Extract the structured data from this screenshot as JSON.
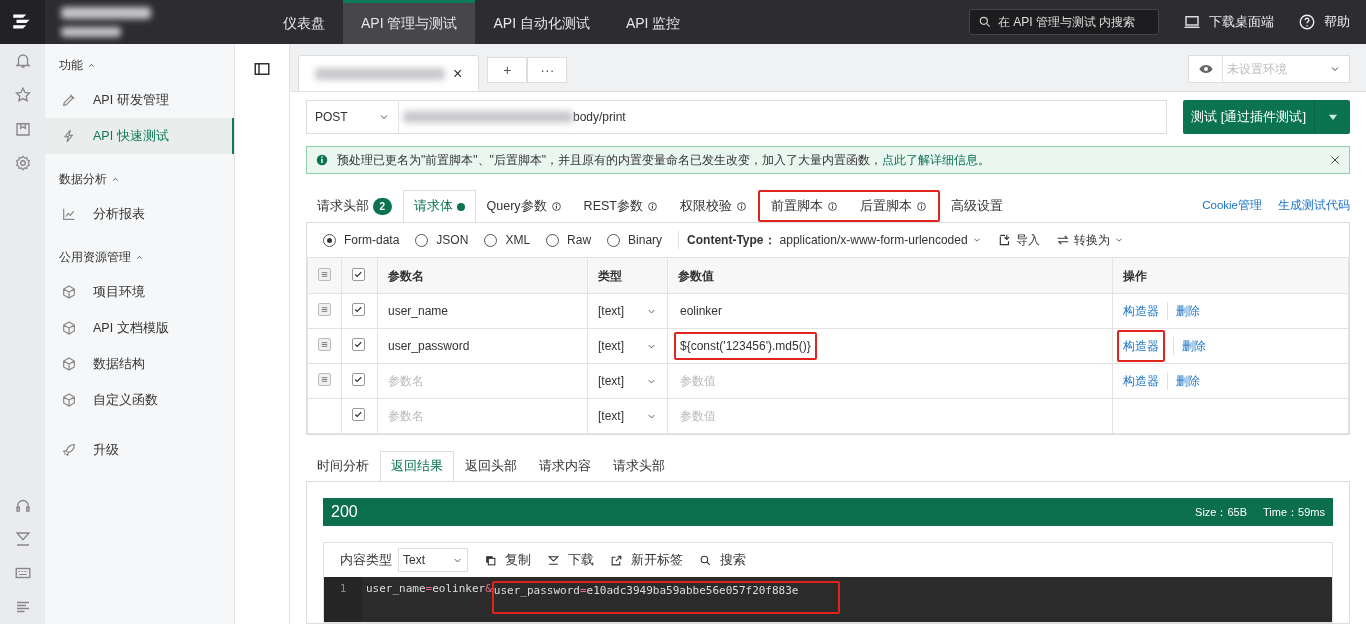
{
  "top_nav": [
    {
      "label": "仪表盘",
      "selected": false
    },
    {
      "label": "API 管理与测试",
      "selected": true
    },
    {
      "label": "API 自动化测试",
      "selected": false
    },
    {
      "label": "API 监控",
      "selected": false
    }
  ],
  "search": {
    "placeholder": "在 API 管理与测试 内搜索"
  },
  "header_actions": [
    {
      "kind": "desktop",
      "label": "下载桌面端"
    },
    {
      "kind": "help",
      "label": "帮助"
    }
  ],
  "sidebar": [
    {
      "title": "功能",
      "expanded": true,
      "items": [
        {
          "label": "API 研发管理",
          "kind": "edit",
          "selected": false
        },
        {
          "label": "API 快速测试",
          "kind": "flash",
          "selected": true
        }
      ]
    },
    {
      "title": "数据分析",
      "expanded": true,
      "items": [
        {
          "label": "分析报表",
          "kind": "chart",
          "selected": false
        }
      ]
    },
    {
      "title": "公用资源管理",
      "expanded": true,
      "items": [
        {
          "label": "项目环境",
          "kind": "cube",
          "selected": false
        },
        {
          "label": "API 文档模版",
          "kind": "cube",
          "selected": false
        },
        {
          "label": "数据结构",
          "kind": "cube",
          "selected": false
        },
        {
          "label": "自定义函数",
          "kind": "cube",
          "selected": false
        }
      ]
    },
    {
      "items": [
        {
          "label": "升级",
          "kind": "rocket",
          "selected": false
        }
      ]
    }
  ],
  "request_tab": {
    "close": "×"
  },
  "tab_buttons": [
    "+",
    "···"
  ],
  "environment": {
    "placeholder": "未设置环境"
  },
  "method": "POST",
  "url": {
    "value": "body/print"
  },
  "test_button": "测试 [通过插件测试]",
  "alert": {
    "text": "预处理已更名为\"前置脚本\"、\"后置脚本\"，并且原有的内置变量命名已发生改变，加入了大量内置函数，",
    "link": "点此了解详细信息",
    "after": "。"
  },
  "request_tabs": [
    {
      "label": "请求头部",
      "badge": "2",
      "selected": false
    },
    {
      "label": "请求体",
      "dot": true,
      "selected": true
    },
    {
      "label": "Query参数",
      "info": true,
      "selected": false
    },
    {
      "label": "REST参数",
      "info": true,
      "selected": false
    },
    {
      "label": "权限校验",
      "info": true,
      "selected": false
    },
    {
      "label": "前置脚本",
      "info": true,
      "selected": false,
      "annotated": true
    },
    {
      "label": "后置脚本",
      "info": true,
      "selected": false,
      "annotated": true
    },
    {
      "label": "高级设置",
      "selected": false
    }
  ],
  "request_links": [
    "Cookie管理",
    "生成测试代码"
  ],
  "body_types": [
    {
      "label": "Form-data",
      "selected": true
    },
    {
      "label": "JSON",
      "selected": false
    },
    {
      "label": "XML",
      "selected": false
    },
    {
      "label": "Raw",
      "selected": false
    },
    {
      "label": "Binary",
      "selected": false
    }
  ],
  "content_type": {
    "label": "Content-Type：",
    "value": "application/x-www-form-urlencoded"
  },
  "body_actions": [
    {
      "kind": "import",
      "label": "导入"
    },
    {
      "kind": "convert",
      "label": "转换为"
    }
  ],
  "table": {
    "header_checked": true,
    "columns": [
      "参数名",
      "类型",
      "参数值",
      "操作"
    ],
    "rows": [
      {
        "draggable": true,
        "checked": true,
        "name": "user_name",
        "type": "[text]",
        "value": "eolinker",
        "actions": [
          {
            "label": "构造器"
          },
          {
            "label": "删除"
          }
        ]
      },
      {
        "draggable": true,
        "checked": true,
        "name": "user_password",
        "type": "[text]",
        "value": "${const('123456').md5()}",
        "value_annotated": true,
        "actions": [
          {
            "label": "构造器",
            "annotated": true
          },
          {
            "label": "删除"
          }
        ]
      },
      {
        "draggable": true,
        "checked": true,
        "name_placeholder": "参数名",
        "type": "[text]",
        "value_placeholder": "参数值",
        "actions": [
          {
            "label": "构造器"
          },
          {
            "label": "删除"
          }
        ]
      },
      {
        "draggable": false,
        "checked": true,
        "name_placeholder": "参数名",
        "type": "[text]",
        "value_placeholder": "参数值"
      }
    ]
  },
  "response_tabs": [
    {
      "label": "时间分析",
      "selected": false
    },
    {
      "label": "返回结果",
      "selected": true
    },
    {
      "label": "返回头部",
      "selected": false
    },
    {
      "label": "请求内容",
      "selected": false
    },
    {
      "label": "请求头部",
      "selected": false
    }
  ],
  "response": {
    "status": "200",
    "size": "Size：65B",
    "time": "Time：59ms",
    "content_type_label": "内容类型",
    "content_type": "Text",
    "tools": [
      {
        "kind": "copy",
        "label": "复制"
      },
      {
        "kind": "download",
        "label": "下载"
      },
      {
        "kind": "newtab",
        "label": "新开标签"
      },
      {
        "kind": "search",
        "label": "搜索"
      }
    ],
    "lines": [
      {
        "number": "1",
        "tokens": [
          {
            "text": "user_name",
            "kind": "text"
          },
          {
            "text": "=",
            "kind": "op"
          },
          {
            "text": "eolinker",
            "kind": "text"
          },
          {
            "text": "&",
            "kind": "op"
          },
          {
            "text": "user_password",
            "kind": "text",
            "annotated": true
          },
          {
            "text": "=",
            "kind": "op",
            "annotated": true
          },
          {
            "text": "e10adc3949ba59abbe56e057f20f883e",
            "kind": "text",
            "annotated": true
          }
        ]
      }
    ]
  }
}
